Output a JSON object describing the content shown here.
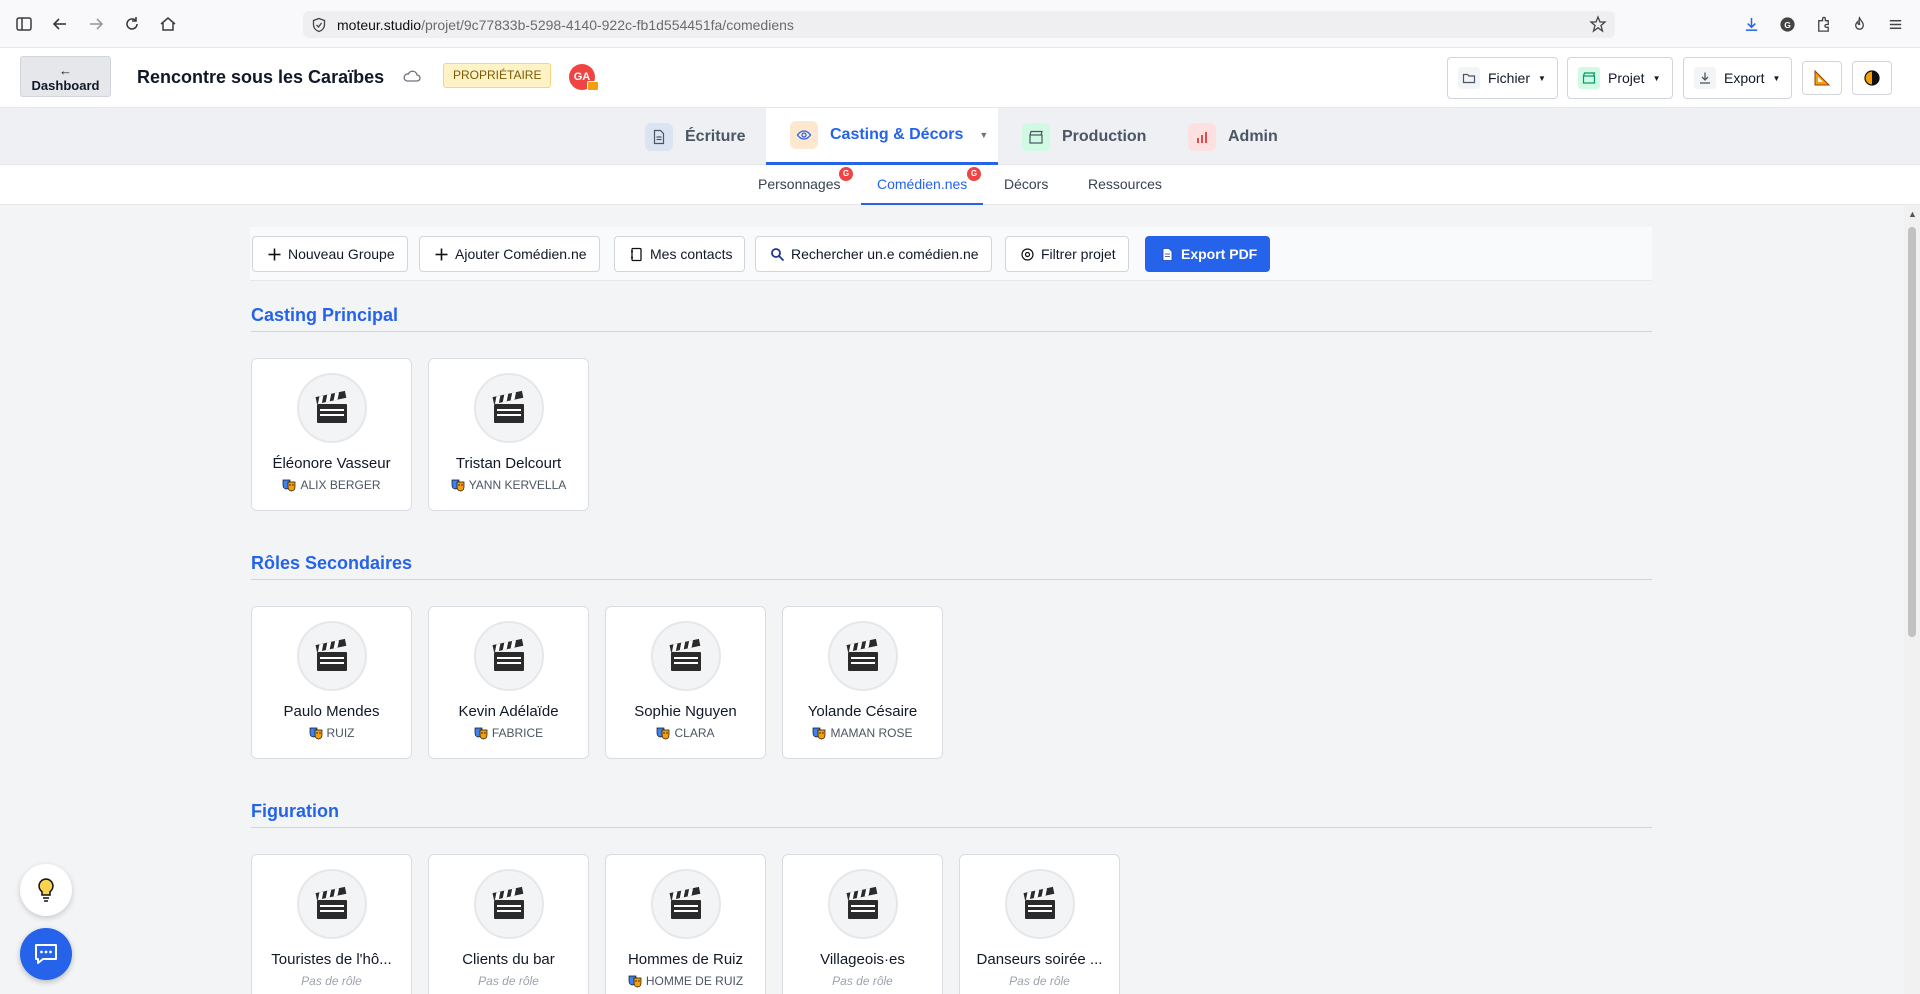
{
  "browser": {
    "url_host": "moteur.studio",
    "url_path": "/projet/9c77833b-5298-4140-922c-fb1d554451fa/comediens"
  },
  "header": {
    "dashboard_arrow": "←",
    "dashboard_label": "Dashboard",
    "project_title": "Rencontre sous les Caraïbes",
    "owner_badge": "PROPRIÉTAIRE",
    "avatar_initials": "GA",
    "fichier_label": "Fichier",
    "projet_label": "Projet",
    "export_label": "Export"
  },
  "main_tabs": [
    {
      "label": "Écriture"
    },
    {
      "label": "Casting & Décors"
    },
    {
      "label": "Production"
    },
    {
      "label": "Admin"
    }
  ],
  "sub_tabs": [
    {
      "label": "Personnages",
      "badge": "G"
    },
    {
      "label": "Comédien.nes",
      "badge": "G"
    },
    {
      "label": "Décors"
    },
    {
      "label": "Ressources"
    }
  ],
  "toolbar": {
    "new_group": "Nouveau Groupe",
    "add_actor": "Ajouter Comédien.ne",
    "contacts": "Mes contacts",
    "search_actor": "Rechercher un.e comédien.ne",
    "filter": "Filtrer projet",
    "export_pdf": "Export PDF"
  },
  "sections": [
    {
      "title": "Casting Principal",
      "cards": [
        {
          "name": "Éléonore Vasseur",
          "role": "ALIX BERGER"
        },
        {
          "name": "Tristan Delcourt",
          "role": "YANN KERVELLA"
        }
      ]
    },
    {
      "title": "Rôles Secondaires",
      "cards": [
        {
          "name": "Paulo Mendes",
          "role": "RUIZ"
        },
        {
          "name": "Kevin Adélaïde",
          "role": "FABRICE"
        },
        {
          "name": "Sophie Nguyen",
          "role": "CLARA"
        },
        {
          "name": "Yolande Césaire",
          "role": "MAMAN ROSE"
        }
      ]
    },
    {
      "title": "Figuration",
      "cards": [
        {
          "name": "Touristes de l'hô...",
          "role": "Pas de rôle"
        },
        {
          "name": "Clients du bar",
          "role": "Pas de rôle"
        },
        {
          "name": "Hommes de Ruiz",
          "role": "HOMME DE RUIZ"
        },
        {
          "name": "Villageois·es",
          "role": "Pas de rôle"
        },
        {
          "name": "Danseurs soirée ...",
          "role": "Pas de rôle"
        }
      ]
    }
  ],
  "colors": {
    "accent": "#2563eb",
    "badge_red": "#ef4444",
    "owner_bg": "#fef3c7"
  }
}
